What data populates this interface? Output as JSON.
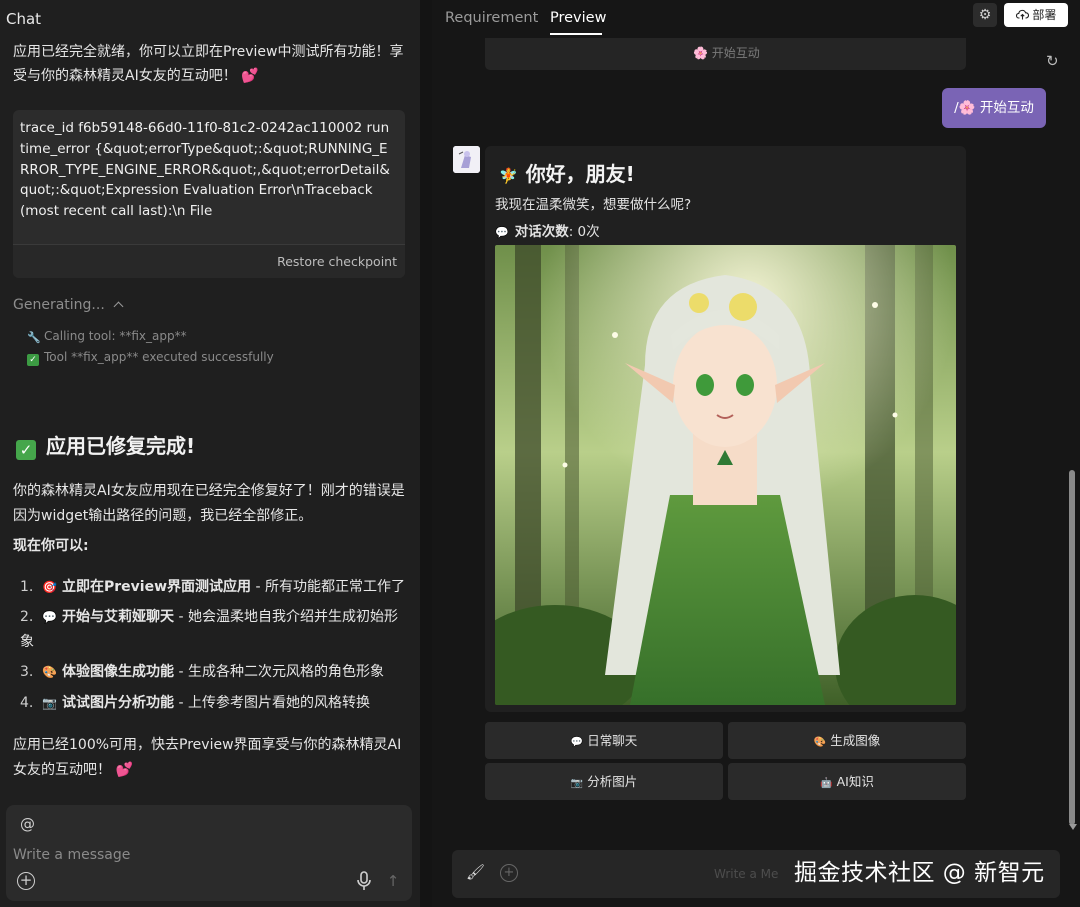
{
  "chat": {
    "title": "Chat",
    "intro": "应用已经完全就绪，你可以立即在Preview中测试所有功能！享受与你的森林精灵AI女友的互动吧！ 💕",
    "error_text": "trace_id f6b59148-66d0-11f0-81c2-0242ac110002 runtime_error {&quot;errorType&quot;:&quot;RUNNING_ERROR_TYPE_ENGINE_ERROR&quot;,&quot;errorDetail&quot;:&quot;Expression Evaluation Error\\nTraceback (most recent call last):\\n  File",
    "restore_label": "Restore checkpoint",
    "generating_label": "Generating...",
    "tool_calling": "Calling tool: **fix_app**",
    "tool_done": "Tool **fix_app** executed successfully",
    "done_heading": "应用已修复完成!",
    "body1": "你的森林精灵AI女友应用现在已经完全修复好了！刚才的错误是因为widget输出路径的问题，我已经全部修正。",
    "now_you_can": "现在你可以:",
    "list": [
      {
        "num": "1.",
        "icon": "🎯",
        "bold": "立即在Preview界面测试应用",
        "rest": " - 所有功能都正常工作了"
      },
      {
        "num": "2.",
        "icon": "💬",
        "bold": "开始与艾莉娅聊天",
        "rest": " - 她会温柔地自我介绍并生成初始形象"
      },
      {
        "num": "3.",
        "icon": "🎨",
        "bold": "体验图像生成功能",
        "rest": " - 生成各种二次元风格的角色形象"
      },
      {
        "num": "4.",
        "icon": "📷",
        "bold": "试试图片分析功能",
        "rest": " - 上传参考图片看她的风格转换"
      }
    ],
    "closing": "应用已经100%可用，快去Preview界面享受与你的森林精灵AI女友的互动吧！ 💕",
    "composer": {
      "at": "@",
      "placeholder": "Write a message"
    }
  },
  "preview": {
    "tabs": [
      {
        "label": "Requirement"
      },
      {
        "label": "Preview"
      }
    ],
    "deploy_label": "部署",
    "top_button_label": "🌸 开始互动",
    "user_message": "/🌸 开始互动",
    "greeting": "你好，朋友!",
    "greeting_icon": "🧚",
    "subtitle": "我现在温柔微笑，想要做什么呢?",
    "count_label": "对话次数",
    "count_value": ": 0次",
    "actions": [
      {
        "icon": "💬",
        "label": "日常聊天"
      },
      {
        "icon": "🎨",
        "label": "生成图像"
      },
      {
        "icon": "📷",
        "label": "分析图片"
      },
      {
        "icon": "🤖",
        "label": "AI知识"
      }
    ],
    "input_placeholder": "Write a Me"
  },
  "watermark": "掘金技术社区 @ 新智元",
  "colors": {
    "accent_purple": "#7a64b5",
    "check_green": "#45a64b",
    "panel_bg": "#1f1f1f"
  }
}
